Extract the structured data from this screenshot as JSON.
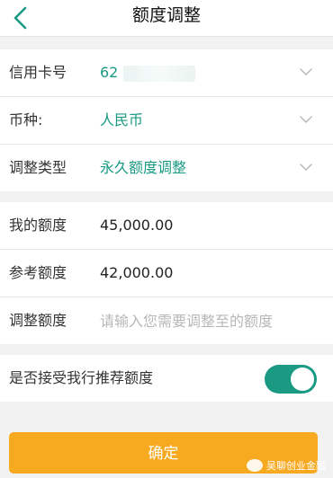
{
  "header": {
    "title": "额度调整",
    "back_icon": "chevron-left-icon"
  },
  "card_info": {
    "card_label": "信用卡号",
    "card_number_prefix": "62",
    "currency_label": "币种:",
    "currency_value": "人民币",
    "adjust_type_label": "调整类型",
    "adjust_type_value": "永久额度调整"
  },
  "amounts": {
    "my_limit_label": "我的额度",
    "my_limit_value": "45,000.00",
    "ref_limit_label": "参考额度",
    "ref_limit_value": "42,000.00",
    "adjust_label": "调整额度",
    "adjust_placeholder": "请输入您需要调整至的额度"
  },
  "recommend": {
    "label": "是否接受我行推荐额度",
    "enabled": true
  },
  "confirm_label": "确定",
  "watermark_text": "吴聊创业金融",
  "colors": {
    "accent": "#1a9a83",
    "button": "#f7a91f"
  }
}
